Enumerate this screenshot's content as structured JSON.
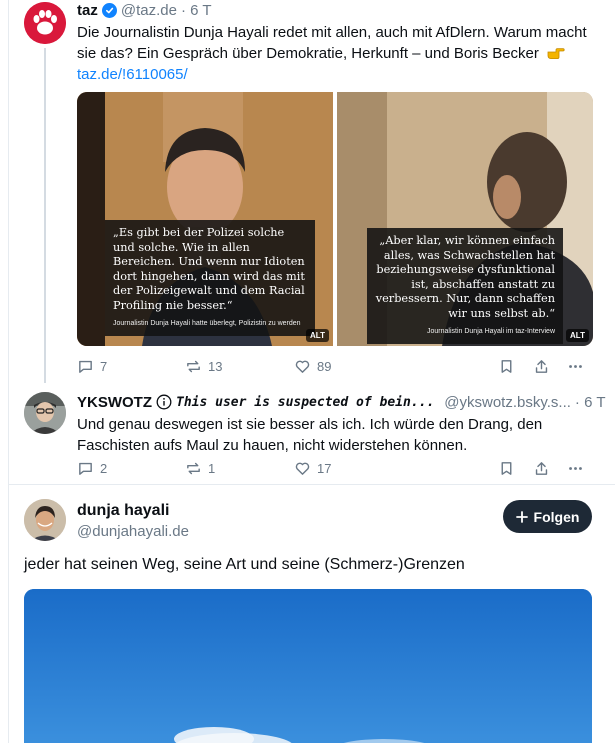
{
  "post1": {
    "author": "taz",
    "handle": "@taz.de",
    "time": "· 6 T",
    "text_main": "Die Journalistin Dunja Hayali redet mit allen, auch mit AfDlern. Warum macht sie das? Ein Gespräch über Demokratie, Herkunft – und Boris Becker",
    "link": "taz.de/!6110065/",
    "image1": {
      "quote": "„Es gibt bei der Polizei solche und solche. Wie in allen Bereichen. Und wenn nur Idioten dort hingehen, dann wird das mit der Polizeigewalt und dem Racial Profiling nie besser.“",
      "caption": "Journalistin Dunja Hayali hatte überlegt, Polizistin zu werden",
      "alt": "ALT"
    },
    "image2": {
      "quote": "„Aber klar, wir können einfach alles, was Schwachstellen hat beziehungsweise dysfunktional ist, abschaffen anstatt zu verbessern. Nur, dann schaffen wir uns selbst ab.“",
      "caption": "Journalistin Dunja Hayali im taz-Interview",
      "alt": "ALT"
    },
    "replies": "7",
    "reposts": "13",
    "likes": "89"
  },
  "post2": {
    "author": "YKSWOTZ",
    "warning": "This user is suspected of bein...",
    "handle": "@ykswotz.bsky.s...",
    "time": "· 6 T",
    "text": "Und genau deswegen ist sie besser als ich. Ich würde den Drang, den Faschisten aufs Maul zu hauen, nicht widerstehen können.",
    "replies": "2",
    "reposts": "1",
    "likes": "17"
  },
  "post3": {
    "author": "dunja hayali",
    "handle": "@dunjahayali.de",
    "follow_label": "Folgen",
    "text": "jeder hat seinen Weg, seine Art und seine (Schmerz-)Grenzen"
  },
  "colors": {
    "accent": "#1083fe",
    "muted": "#6a7886",
    "thread": "#d4dbe2",
    "button_dark": "#1e2936",
    "taz_red": "#d9183b"
  }
}
